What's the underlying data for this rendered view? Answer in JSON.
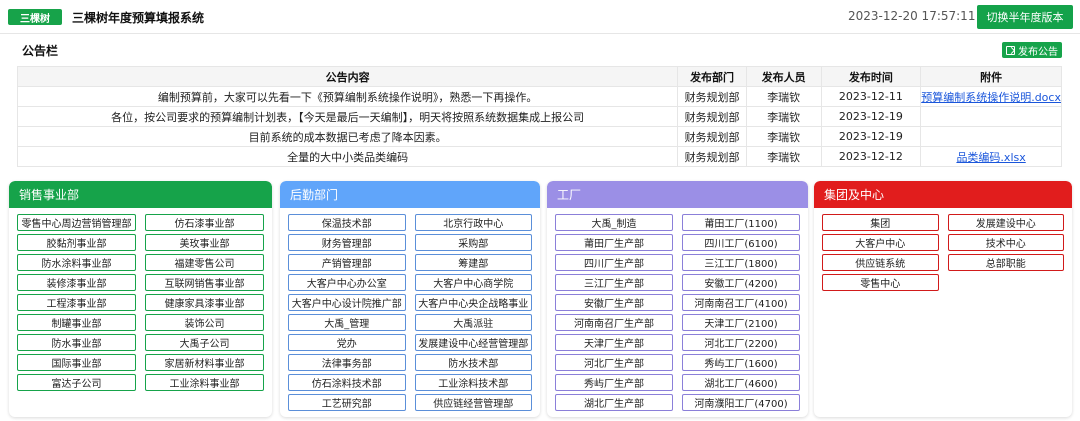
{
  "header": {
    "logo_text": "三棵树",
    "app_title": "三棵树年度预算填报系统",
    "datetime": "2023-12-20 17:57:11",
    "switch_button": "切换半年度版本"
  },
  "notice": {
    "title": "公告栏",
    "publish_button": "发布公告",
    "columns": [
      "公告内容",
      "发布部门",
      "发布人员",
      "发布时间",
      "附件"
    ],
    "rows": [
      {
        "content": "编制预算前，大家可以先看一下《预算编制系统操作说明》，熟悉一下再操作。",
        "dept": "财务规划部",
        "person": "李瑞钦",
        "date": "2023-12-11",
        "attachment": "预算编制系统操作说明.docx"
      },
      {
        "content": "各位，按公司要求的预算编制计划表，【今天是最后一天编制】，明天将按照系统数据集成上报公司",
        "dept": "财务规划部",
        "person": "李瑞钦",
        "date": "2023-12-19",
        "attachment": ""
      },
      {
        "content": "目前系统的成本数据已考虑了降本因素。",
        "dept": "财务规划部",
        "person": "李瑞钦",
        "date": "2023-12-19",
        "attachment": ""
      },
      {
        "content": "全量的大中小类品类编码",
        "dept": "财务规划部",
        "person": "李瑞钦",
        "date": "2023-12-12",
        "attachment": "品类编码.xlsx"
      }
    ]
  },
  "panels": {
    "sales": {
      "title": "销售事业部",
      "color": "#16a34a",
      "items": [
        "零售中心周边营销管理部",
        "仿石漆事业部",
        "胶黏剂事业部",
        "美玫事业部",
        "防水涂料事业部",
        "福建零售公司",
        "装修漆事业部",
        "互联网销售事业部",
        "工程漆事业部",
        "健康家具漆事业部",
        "制罐事业部",
        "装饰公司",
        "防水事业部",
        "大禹子公司",
        "国际事业部",
        "家居新材料事业部",
        "富达子公司",
        "工业涂料事业部"
      ]
    },
    "logistics": {
      "title": "后勤部门",
      "color": "#60a5fa",
      "items": [
        "保温技术部",
        "北京行政中心",
        "财务管理部",
        "采购部",
        "产销管理部",
        "筹建部",
        "大客户中心办公室",
        "大客户中心商学院",
        "大客户中心设计院推广部",
        "大客户中心央企战略事业",
        "大禹_管理",
        "大禹派驻",
        "党办",
        "发展建设中心经营管理部",
        "法律事务部",
        "防水技术部",
        "仿石涂料技术部",
        "工业涂料技术部",
        "工艺研究部",
        "供应链经营管理部"
      ]
    },
    "factory": {
      "title": "工厂",
      "color": "#9b8fe6",
      "items": [
        "大禹_制造",
        "莆田工厂(1100)",
        "莆田厂生产部",
        "四川工厂(6100)",
        "四川厂生产部",
        "三江工厂(1800)",
        "三江厂生产部",
        "安徽工厂(4200)",
        "安徽厂生产部",
        "河南南召工厂(4100)",
        "河南南召厂生产部",
        "天津工厂(2100)",
        "天津厂生产部",
        "河北工厂(2200)",
        "河北厂生产部",
        "秀屿工厂(1600)",
        "秀屿厂生产部",
        "湖北工厂(4600)",
        "湖北厂生产部",
        "河南濮阳工厂(4700)"
      ]
    },
    "group": {
      "title": "集团及中心",
      "color": "#e11d1d",
      "items": [
        "集团",
        "发展建设中心",
        "大客户中心",
        "技术中心",
        "供应链系统",
        "总部职能",
        "零售中心"
      ]
    }
  }
}
